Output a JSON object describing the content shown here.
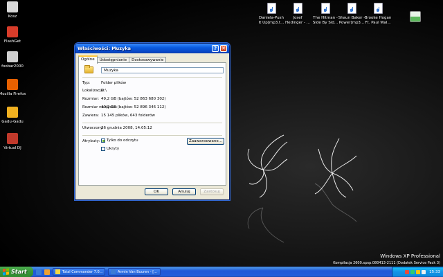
{
  "desktop": {
    "left_icons": [
      {
        "name": "recycle-bin-icon",
        "label": "Kosz",
        "color": "#d8d8d8"
      },
      {
        "name": "flashget-icon",
        "label": "FlashGet",
        "color": "#d83c2a"
      },
      {
        "name": "foobar2000-icon",
        "label": "foobar2000",
        "color": "#cfcfcf"
      },
      {
        "name": "firefox-icon",
        "label": "Mozilla Firefox",
        "color": "#e66000"
      },
      {
        "name": "gadu-gadu-icon",
        "label": "Gadu-Gadu",
        "color": "#f0b020"
      },
      {
        "name": "virtual-dj-icon",
        "label": "Virtual DJ",
        "color": "#c0392b"
      }
    ],
    "top_files": [
      {
        "label1": "Daniela-Push",
        "label2": "It Up[mp3.t..."
      },
      {
        "label1": "Josef",
        "label2": "Hedinger - ..."
      },
      {
        "label1": "The Hitman -",
        "label2": "Side By Sid..."
      },
      {
        "label1": "Shaun Baker -",
        "label2": "Power[mp3..."
      },
      {
        "label1": "Brooke Hogan",
        "label2": "Ft. Paul Wal..."
      }
    ],
    "watermark": {
      "line1": "Windows XP Professional",
      "line2": "Kompilacja 2600.xpsp.080413-2111 (Dodatek Service Pack 3)"
    }
  },
  "dialog": {
    "title": "Właściwości: Muzyka",
    "help_glyph": "?",
    "close_glyph": "✕",
    "tabs": [
      "Ogólne",
      "Udostępnianie",
      "Dostosowywanie"
    ],
    "folder_name": "Muzyka",
    "fields": {
      "type_label": "Typ:",
      "type_value": "Folder plików",
      "location_label": "Lokalizacja:",
      "location_value": "D:\\",
      "size_label": "Rozmiar:",
      "size_value": "49,2 GB (bajtów: 52 863 680 302)",
      "disk_size_label": "Rozmiar na dysku:",
      "disk_size_value": "49,2 GB (bajtów: 52 896 346 112)",
      "contains_label": "Zawiera:",
      "contains_value": "15 145 plików, 643 folderów",
      "created_label": "Utworzony:",
      "created_value": "26 grudnia 2008, 14:05:12",
      "attributes_label": "Atrybuty:"
    },
    "readonly_label": "Tylko do odczytu",
    "hidden_label": "Ukryty",
    "advanced_button": "Zaawansowane...",
    "ok_button": "OK",
    "cancel_button": "Anuluj",
    "apply_button": "Zastosuj"
  },
  "taskbar": {
    "start_label": "Start",
    "tasks": [
      {
        "label": "Total Commander 7.0...",
        "icon_color": "#f5d742"
      },
      {
        "label": "Armin Van Buuren - [...",
        "icon_color": "#3a7bd5"
      }
    ],
    "clock": "15:33"
  }
}
